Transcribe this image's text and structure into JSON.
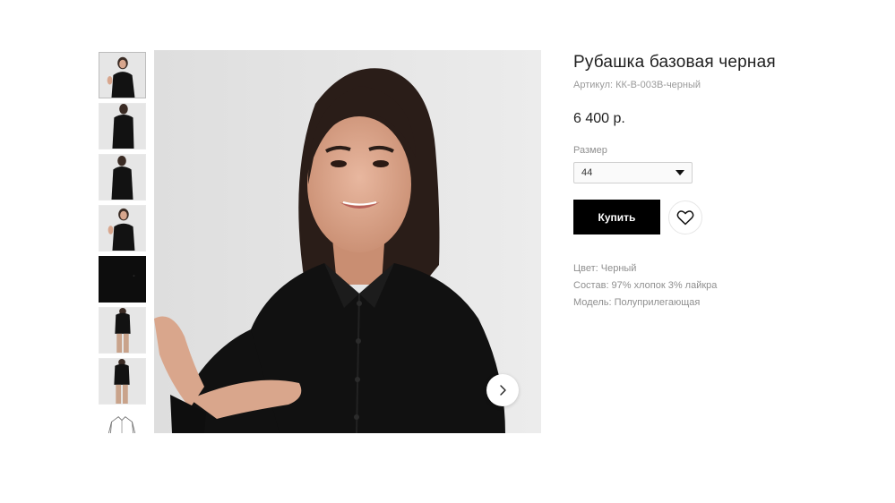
{
  "product": {
    "title": "Рубашка базовая черная",
    "sku": "Артикул: КК-В-003В-черный",
    "price": "6 400 р.",
    "size_label": "Размер",
    "size_value": "44",
    "buy_label": "Купить",
    "specs": {
      "color": "Цвет: Черный",
      "composition": "Состав: 97% хлопок 3% лайкра",
      "fit": "Модель: Полуприлегающая"
    }
  },
  "gallery": {
    "thumbnails": [
      {
        "kind": "portrait-hand"
      },
      {
        "kind": "side-view"
      },
      {
        "kind": "side-view-2"
      },
      {
        "kind": "portrait-hand-2"
      },
      {
        "kind": "fabric-closeup"
      },
      {
        "kind": "full-body"
      },
      {
        "kind": "full-body-2"
      },
      {
        "kind": "sketch"
      }
    ],
    "active_index": 0
  },
  "icons": {
    "next": "chevron-right-icon",
    "favorite": "heart-icon",
    "dropdown": "caret-down-icon"
  },
  "colors": {
    "accent": "#000000",
    "muted_text": "#8f8f8f",
    "image_bg": "#e3e3e3"
  }
}
